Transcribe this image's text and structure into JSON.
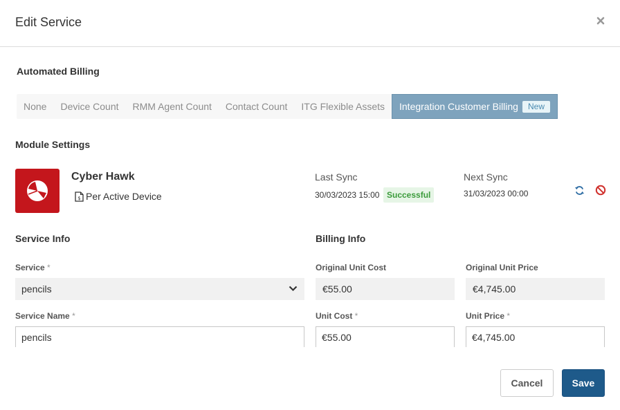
{
  "modal": {
    "title": "Edit Service"
  },
  "automated_billing": {
    "heading": "Automated Billing",
    "tabs": [
      {
        "label": "None",
        "active": false
      },
      {
        "label": "Device Count",
        "active": false
      },
      {
        "label": "RMM Agent Count",
        "active": false
      },
      {
        "label": "Contact Count",
        "active": false
      },
      {
        "label": "ITG Flexible Assets",
        "active": false
      },
      {
        "label": "Integration Customer Billing",
        "active": true,
        "badge": "New"
      }
    ]
  },
  "module_settings": {
    "heading": "Module Settings",
    "integration": {
      "name": "Cyber Hawk",
      "billing_mode": "Per Active Device",
      "logo_color": "#c4161c"
    },
    "last_sync": {
      "label": "Last Sync",
      "value": "30/03/2023 15:00",
      "status": "Successful"
    },
    "next_sync": {
      "label": "Next Sync",
      "value": "31/03/2023 00:00"
    },
    "actions": {
      "sync_icon": "sync-icon",
      "disable_icon": "ban-icon"
    }
  },
  "service_info": {
    "heading": "Service Info",
    "service_label": "Service",
    "service_value": "pencils",
    "service_name_label": "Service Name",
    "service_name_value": "pencils",
    "required_mark": "*"
  },
  "billing_info": {
    "heading": "Billing Info",
    "original_unit_cost_label": "Original Unit Cost",
    "original_unit_cost_value": "€55.00",
    "original_unit_price_label": "Original Unit Price",
    "original_unit_price_value": "€4,745.00",
    "unit_cost_label": "Unit Cost",
    "unit_cost_value": "€55.00",
    "unit_price_label": "Unit Price",
    "unit_price_value": "€4,745.00"
  },
  "footer": {
    "cancel_label": "Cancel",
    "save_label": "Save"
  },
  "colors": {
    "primary": "#1e5a8a",
    "active_tab": "#7ea3bd",
    "success": "#3b9b3b",
    "danger": "#d0312d"
  }
}
